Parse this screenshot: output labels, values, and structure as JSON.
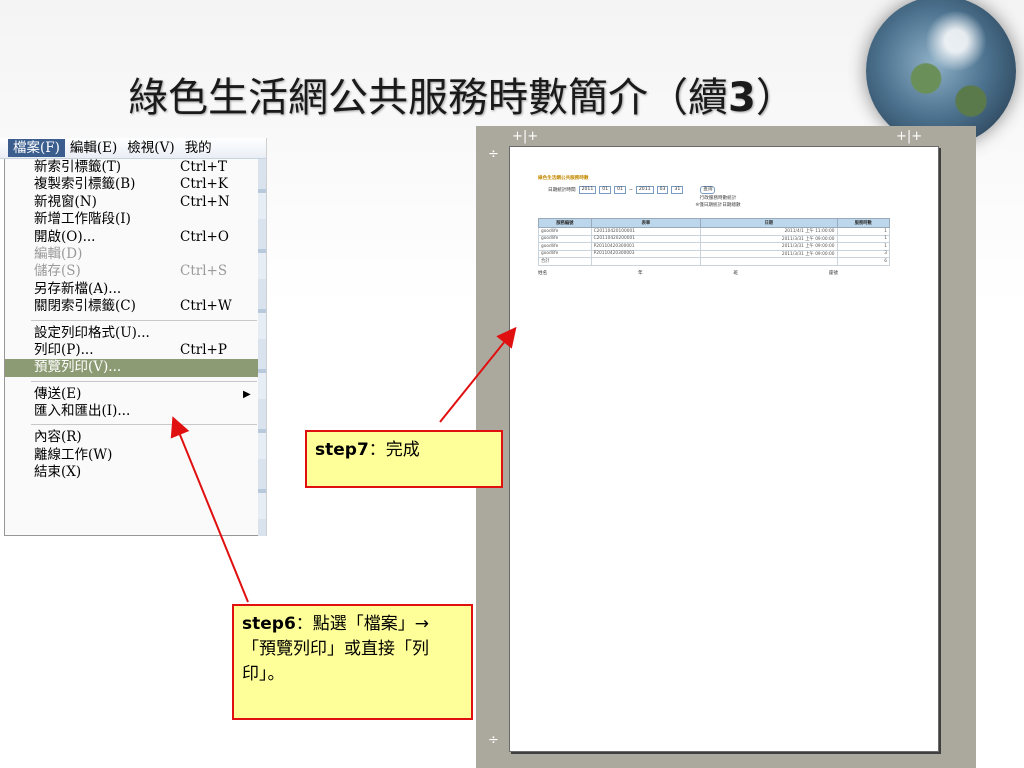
{
  "slide": {
    "title": "綠色生活網公共服務時數簡介（續",
    "title_number": "3",
    "title_close": "）"
  },
  "menubar": [
    "檔案(F)",
    "編輯(E)",
    "檢視(V)",
    "我的"
  ],
  "menu": [
    {
      "label": "新索引標籤(T)",
      "shortcut": "Ctrl+T"
    },
    {
      "label": "複製索引標籤(B)",
      "shortcut": "Ctrl+K"
    },
    {
      "label": "新視窗(N)",
      "shortcut": "Ctrl+N"
    },
    {
      "label": "新增工作階段(I)",
      "shortcut": ""
    },
    {
      "label": "開啟(O)...",
      "shortcut": "Ctrl+O"
    },
    {
      "label": "編輯(D)",
      "shortcut": "",
      "disabled": true
    },
    {
      "label": "儲存(S)",
      "shortcut": "Ctrl+S",
      "disabled": true
    },
    {
      "label": "另存新檔(A)...",
      "shortcut": ""
    },
    {
      "label": "關閉索引標籤(C)",
      "shortcut": "Ctrl+W"
    },
    {
      "label": "設定列印格式(U)...",
      "shortcut": ""
    },
    {
      "label": "列印(P)...",
      "shortcut": "Ctrl+P"
    },
    {
      "label": "預覽列印(V)...",
      "shortcut": "",
      "highlight": true
    },
    {
      "label": "傳送(E)",
      "shortcut": "",
      "submenu": true
    },
    {
      "label": "匯入和匯出(I)...",
      "shortcut": ""
    },
    {
      "label": "內容(R)",
      "shortcut": ""
    },
    {
      "label": "離線工作(W)",
      "shortcut": ""
    },
    {
      "label": "結束(X)",
      "shortcut": ""
    }
  ],
  "preview": {
    "header": "綠色生活網公共服務時數",
    "query_label": "日期統計時間",
    "year": "2011",
    "month_from": "01",
    "day_from": "01",
    "month_to": "03",
    "day_to": "31",
    "query_button": "查詢",
    "note1": "行政服務時數統計",
    "note2": "※僅日期統計日期總數",
    "columns": [
      "服務編號",
      "表單",
      "日期",
      "服務時數"
    ],
    "rows": [
      [
        "goodlife",
        "C20110420100001",
        "2011/4/1 上午 11:00:00",
        "1"
      ],
      [
        "goodlife",
        "C20110420200001",
        "2011/3/31 上午 09:00:00",
        "1"
      ],
      [
        "goodlife",
        "P20110420300001",
        "2011/3/31 上午 09:00:00",
        "1"
      ],
      [
        "goodlife",
        "P20110420300003",
        "2011/3/31 上午 09:00:00",
        "3"
      ],
      [
        "合計",
        "",
        "",
        "6"
      ]
    ],
    "footer": [
      "姓名",
      "年",
      "班",
      "座號"
    ]
  },
  "callouts": {
    "step7_label": "step7",
    "step7_text": "：完成",
    "step6_label": "step6",
    "step6_text": "：點選「檔案」→「預覽列印」或直接「列印」。"
  },
  "colors": {
    "arrow": "#e01010",
    "callout_bg": "#ffff99",
    "highlight": "#8d9b74"
  }
}
